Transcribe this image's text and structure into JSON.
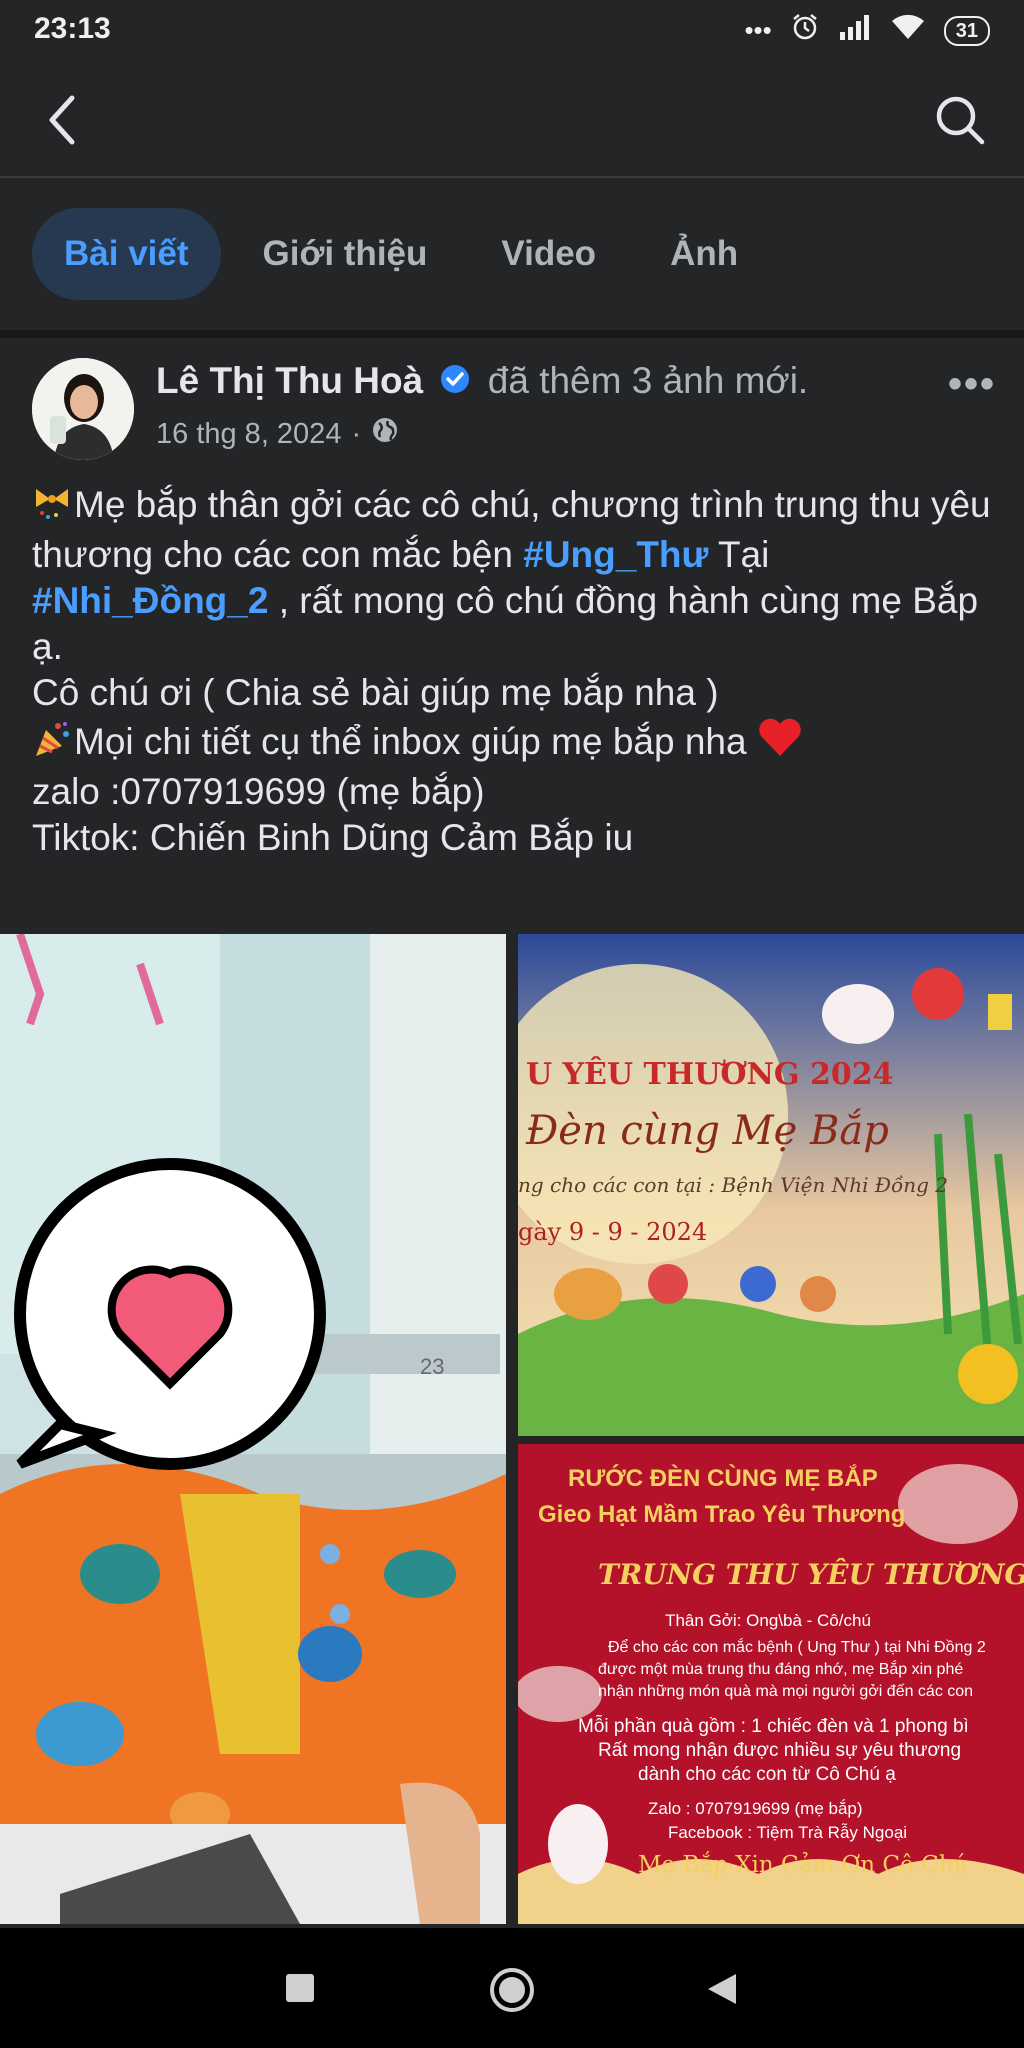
{
  "status_bar": {
    "time": "23:13",
    "dots": "•••",
    "battery": "31"
  },
  "tabs": [
    {
      "label": "Bài viết",
      "active": true
    },
    {
      "label": "Giới thiệu"
    },
    {
      "label": "Video"
    },
    {
      "label": "Ảnh"
    }
  ],
  "post": {
    "author": "Lê Thị Thu Hoà",
    "action": "đã thêm 3 ảnh mới.",
    "date": "16 thg 8, 2024",
    "separator": "·",
    "more": "•••",
    "text": {
      "line1_a": "Mẹ bắp thân gởi các cô chú, chương trình trung thu yêu thương cho các con mắc bện ",
      "hashtag1": "#Ung_Thư",
      "line1_b": " Tại ",
      "hashtag2": "#Nhi_Đồng_2",
      "line1_c": " , rất mong cô chú đồng hành cùng mẹ Bắp ạ.",
      "line2": "Cô chú ơi ( Chia sẻ bài giúp mẹ bắp nha )",
      "line3": "Mọi chi tiết cụ thể inbox giúp mẹ bắp nha",
      "line4": "zalo :0707919699 (mẹ bắp)",
      "line5": "Tiktok: Chiến Binh Dũng Cảm Bắp iu"
    }
  },
  "photo_top_right": {
    "title": "U YÊU THƯƠNG 2024",
    "subtitle": "Đèn cùng Mẹ Bắp",
    "line": "ng cho các con tại : Bệnh Viện Nhi Đồng 2",
    "date": "gày 9 - 9 - 2024"
  },
  "photo_bottom_right": {
    "heading1": "RƯỚC ĐÈN CÙNG MẸ BẮP",
    "heading2": "Gieo Hạt Mầm Trao Yêu Thương",
    "heading3": "TRUNG THU YÊU THƯƠNG",
    "greeting": "Thân Gởi: Ong\\bà - Cô/chú",
    "line1": "Để cho các con mắc bệnh ( Ung Thư ) tại Nhi Đồng 2",
    "line2": "được một mùa trung thu đáng nhớ, mẹ Bắp xin phé",
    "line3": "nhận những món quà mà mọi người gởi đến các con",
    "line4": "Mỗi phần quà gồm : 1 chiếc đèn và 1 phong bì",
    "line5": "Rất mong nhận được nhiều sự yêu thương",
    "line6": "dành cho các con từ Cô Chú ạ",
    "zalo": "Zalo : 0707919699 (mẹ bắp)",
    "facebook": "Facebook : Tiệm Trà Rẫy Ngoại",
    "thanks": "Mẹ Bắp Xin Cảm Ơn Cô Chú"
  },
  "photo_left": {
    "wall_number": "23"
  }
}
